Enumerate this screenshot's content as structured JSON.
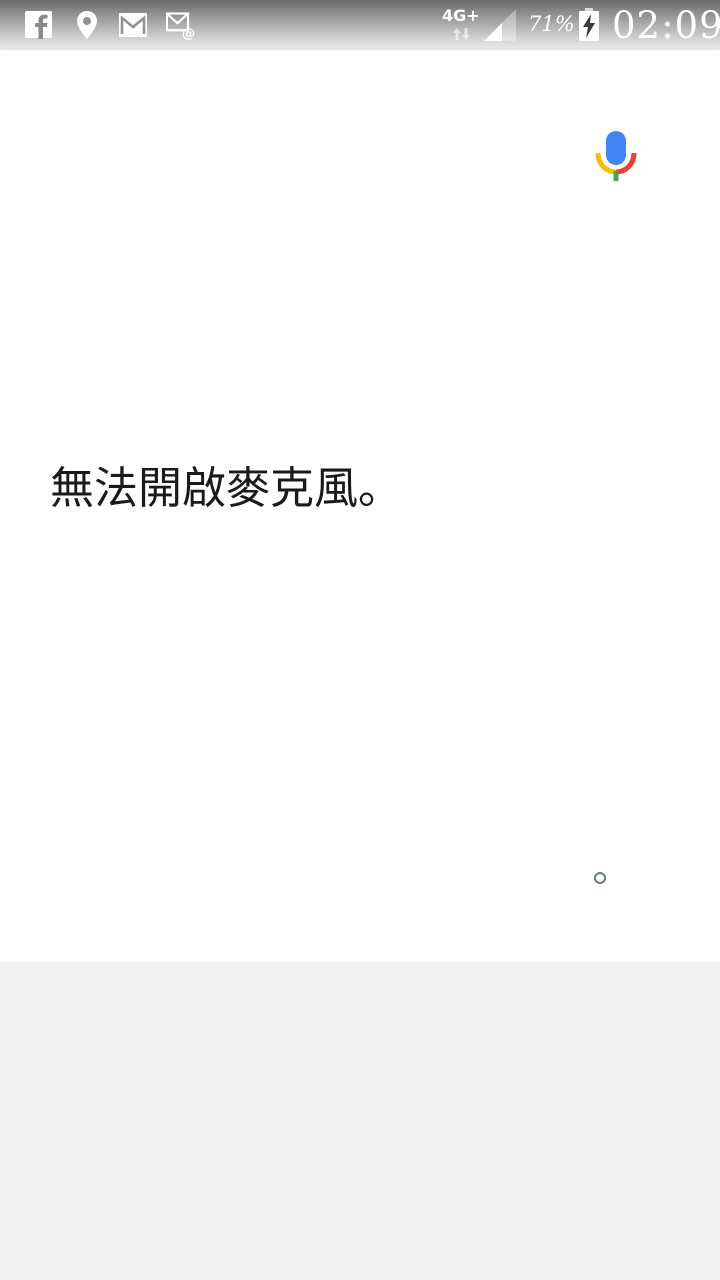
{
  "status_bar": {
    "left_icons": [
      "facebook-icon",
      "location-icon",
      "gmail-icon",
      "email-icon"
    ],
    "network_type": "4G+",
    "battery_percent": "71%",
    "time": "02:09"
  },
  "voice": {
    "message": "無法開啟麥克風。",
    "mic_colors": {
      "blue": "#4285f4",
      "red": "#ea4335",
      "yellow": "#fbbc05",
      "green": "#34a853"
    }
  }
}
